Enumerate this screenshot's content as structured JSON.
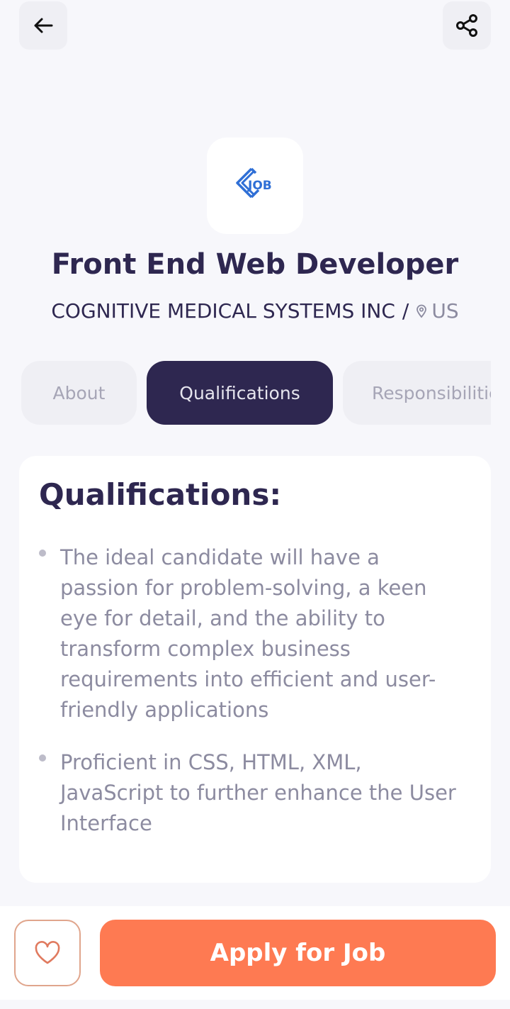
{
  "header": {
    "back_icon": "arrow-left-icon",
    "share_icon": "share-icon"
  },
  "company_logo": {
    "text": "JOB",
    "color": "#2F6FD6"
  },
  "job": {
    "title": "Front End Web Developer",
    "company": "COGNITIVE MEDICAL SYSTEMS INC",
    "separator": "/",
    "location": "US"
  },
  "tabs": [
    {
      "label": "About",
      "active": false
    },
    {
      "label": "Qualifications",
      "active": true
    },
    {
      "label": "Responsibilities",
      "active": false
    }
  ],
  "qualifications": {
    "heading": "Qualifications:",
    "points": [
      "The ideal candidate will have a passion for problem-solving, a keen eye for detail, and the ability to transform complex business requirements into efficient and user-friendly applications",
      "Proficient in CSS, HTML, XML, JavaScript to further enhance the User Interface"
    ]
  },
  "footer": {
    "favorite_icon": "heart-icon",
    "apply_label": "Apply for Job"
  },
  "colors": {
    "primary_dark": "#2E2750",
    "accent": "#FE7A52",
    "background": "#F7F7FB"
  }
}
